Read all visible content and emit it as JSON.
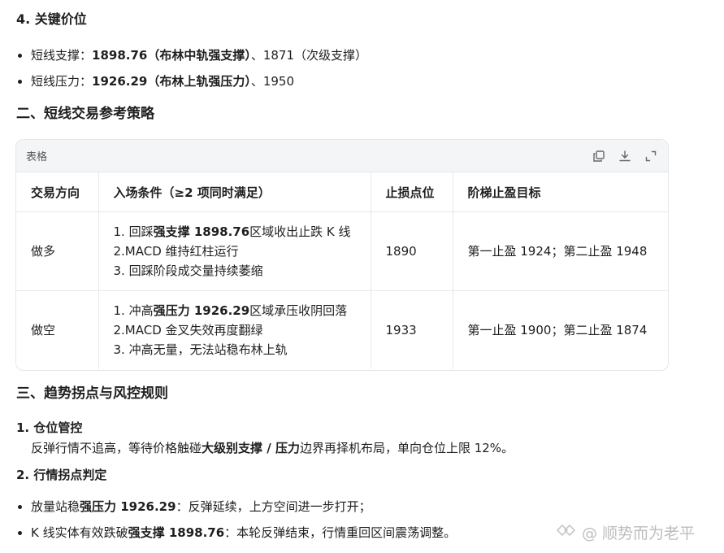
{
  "section4": {
    "title": "4. 关键价位",
    "support": {
      "prefix": "短线支撑：",
      "bold": "1898.76（布林中轨强支撑）",
      "suffix": "、1871（次级支撑）"
    },
    "resistance": {
      "prefix": "短线压力：",
      "bold": "1926.29（布林上轨强压力）",
      "suffix": "、1950"
    }
  },
  "section2": {
    "title": "二、短线交易参考策略",
    "table_card": {
      "title": "表格",
      "headers": [
        "交易方向",
        "入场条件（≥2 项同时满足）",
        "止损点位",
        "阶梯止盈目标"
      ],
      "rows": [
        {
          "direction": "做多",
          "cond1_pre": "1. 回踩",
          "cond1_bold": "强支撑 1898.76",
          "cond1_post": "区域收出止跌 K 线",
          "cond2": "2.MACD 维持红柱运行",
          "cond3": "3. 回踩阶段成交量持续萎缩",
          "stop": "1890",
          "targets": "第一止盈 1924；第二止盈 1948"
        },
        {
          "direction": "做空",
          "cond1_pre": "1. 冲高",
          "cond1_bold": "强压力 1926.29",
          "cond1_post": "区域承压收阴回落",
          "cond2": "2.MACD 金叉失效再度翻绿",
          "cond3": "3. 冲高无量，无法站稳布林上轨",
          "stop": "1933",
          "targets": "第一止盈 1900；第二止盈 1874"
        }
      ]
    }
  },
  "section3": {
    "title": "三、趋势拐点与风控规则",
    "item1": {
      "title": "1. 仓位管控",
      "body_pre": "反弹行情不追高，等待价格触碰",
      "body_bold": "大级别支撑 / 压力",
      "body_post": "边界再择机布局，单向仓位上限 12%。"
    },
    "item2": {
      "title": "2. 行情拐点判定"
    },
    "bullet1": {
      "pre": "放量站稳",
      "bold": "强压力 1926.29",
      "post": "：反弹延续，上方空间进一步打开；"
    },
    "bullet2": {
      "pre": "K 线实体有效跌破",
      "bold": "强支撑 1898.76",
      "post": "：本轮反弹结束，行情重回区间震荡调整。"
    }
  },
  "watermark": {
    "text": "@ 顺势而为老平"
  }
}
